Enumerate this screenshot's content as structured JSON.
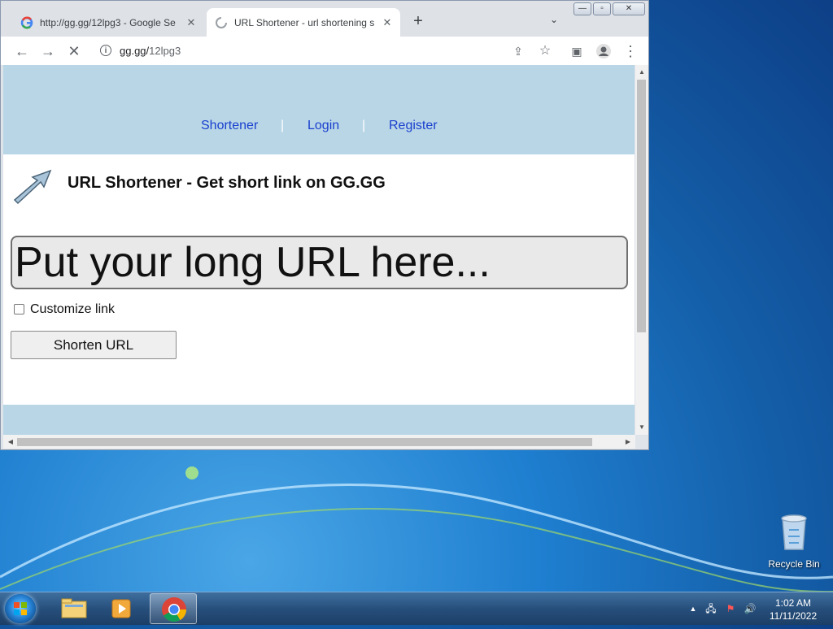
{
  "browser": {
    "tabs": [
      {
        "title": "http://gg.gg/12lpg3 - Google Se",
        "active": false
      },
      {
        "title": "URL Shortener - url shortening s",
        "active": true
      }
    ],
    "new_tab": "+",
    "address": {
      "host": "gg.gg/",
      "path": "12lpg3"
    }
  },
  "page": {
    "nav": [
      "Shortener",
      "Login",
      "Register"
    ],
    "nav_separator": "|",
    "heading": "URL Shortener - Get short link on GG.GG",
    "url_input_placeholder": "Put your long URL here...",
    "customize_label": "Customize link",
    "shorten_button": "Shorten URL"
  },
  "desktop": {
    "recycle_bin": "Recycle Bin"
  },
  "taskbar": {
    "time": "1:02 AM",
    "date": "11/11/2022"
  }
}
